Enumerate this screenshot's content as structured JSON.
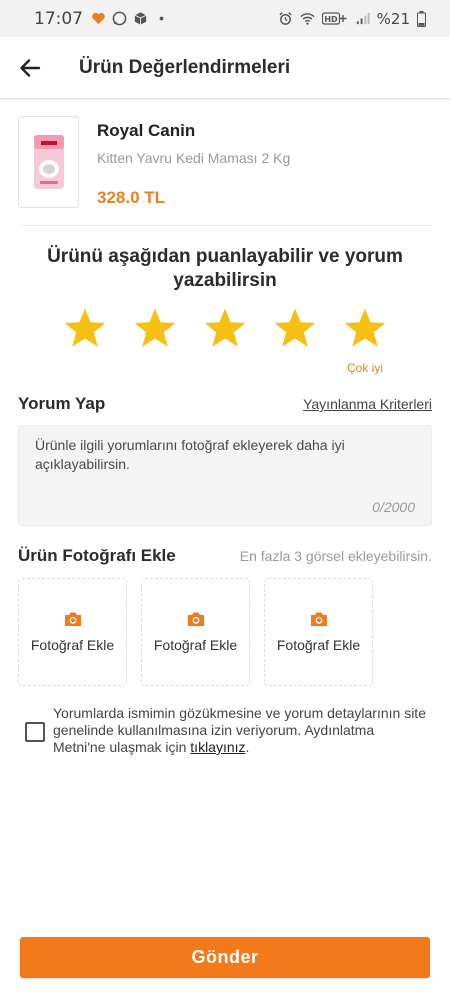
{
  "status_bar": {
    "time": "17:07",
    "battery": "%21",
    "left_icons": [
      "heart-icon",
      "whatsapp-icon",
      "package-icon",
      "dot-icon"
    ],
    "right_icons": [
      "alarm-icon",
      "wifi-icon",
      "hd-icon",
      "signal-icon",
      "battery-icon"
    ]
  },
  "header": {
    "back_icon": "arrow-left-icon",
    "title": "Ürün Değerlendirmeleri"
  },
  "product": {
    "brand": "Royal Canin",
    "name": "Kitten Yavru Kedi Maması 2 Kg",
    "price": "328.0 TL"
  },
  "rating": {
    "prompt": "Ürünü aşağıdan puanlayabilir ve yorum yazabilirsin",
    "stars": 5,
    "max_stars": 5,
    "label": "Çok iyi",
    "star_color": "#f5bf14"
  },
  "comment": {
    "title": "Yorum Yap",
    "criteria_link": "Yayınlanma Kriterleri",
    "placeholder": "Ürünle ilgili yorumlarını fotoğraf ekleyerek daha iyi açıklayabilirsin.",
    "counter": "0/2000"
  },
  "photos": {
    "title": "Ürün Fotoğrafı Ekle",
    "hint": "En fazla 3 görsel ekleyebilirsin.",
    "slots": [
      {
        "label": "Fotoğraf Ekle",
        "icon": "camera-icon"
      },
      {
        "label": "Fotoğraf Ekle",
        "icon": "camera-icon"
      },
      {
        "label": "Fotoğraf Ekle",
        "icon": "camera-icon"
      }
    ]
  },
  "consent": {
    "checked": false,
    "text": "Yorumlarda ismimin gözükmesine ve yorum detaylarının site genelinde kullanılmasına izin veriyorum. Aydınlatma Metni'ne ulaşmak için ",
    "link_text": "tıklayınız",
    "suffix": "."
  },
  "submit": {
    "label": "Gönder"
  },
  "colors": {
    "accent": "#f27a1a",
    "price": "#e8811e",
    "star": "#f5bf14"
  }
}
